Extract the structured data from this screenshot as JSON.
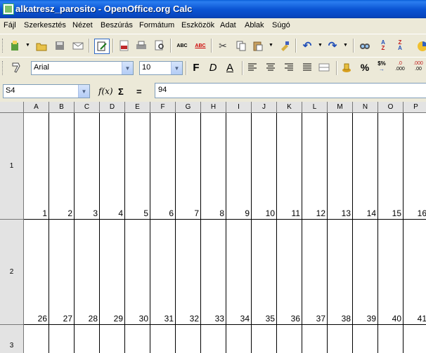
{
  "window": {
    "title": "alkatresz_parosito - OpenOffice.org Calc"
  },
  "menu": [
    "Fájl",
    "Szerkesztés",
    "Nézet",
    "Beszúrás",
    "Formátum",
    "Eszközök",
    "Adat",
    "Ablak",
    "Súgó"
  ],
  "format_toolbar": {
    "font_name": "Arial",
    "font_size": "10"
  },
  "formula_bar": {
    "cell_ref": "S4",
    "formula": "94",
    "function_wizard": "f(x)",
    "sum_symbol": "Σ",
    "equals_symbol": "="
  },
  "columns": [
    "A",
    "B",
    "C",
    "D",
    "E",
    "F",
    "G",
    "H",
    "I",
    "J",
    "K",
    "L",
    "M",
    "N",
    "O",
    "P"
  ],
  "rows": [
    {
      "label": "1",
      "values": [
        "1",
        "2",
        "3",
        "4",
        "5",
        "6",
        "7",
        "8",
        "9",
        "10",
        "11",
        "12",
        "13",
        "14",
        "15",
        "16"
      ]
    },
    {
      "label": "2",
      "values": [
        "26",
        "27",
        "28",
        "29",
        "30",
        "31",
        "32",
        "33",
        "34",
        "35",
        "36",
        "37",
        "38",
        "39",
        "40",
        "41"
      ]
    },
    {
      "label": "3",
      "values": []
    }
  ],
  "toolbar_icons": {
    "standard": [
      "new-document-icon",
      "open-icon",
      "save-icon",
      "email-icon",
      "edit-file-icon",
      "export-pdf-icon",
      "print-icon",
      "page-preview-icon",
      "spellcheck-icon",
      "autospellcheck-icon",
      "cut-icon",
      "copy-icon",
      "paste-icon",
      "format-paintbrush-icon",
      "undo-icon",
      "redo-icon",
      "navigator-icon",
      "sort-ascending-icon",
      "sort-descending-icon",
      "chart-icon"
    ],
    "formatting": [
      "styles-icon",
      "bold-icon",
      "italic-icon",
      "underline-icon",
      "align-left-icon",
      "align-center-icon",
      "align-right-icon",
      "justify-icon",
      "merge-cells-icon",
      "currency-icon",
      "percent-icon",
      "standard-format-icon",
      "add-decimal-icon"
    ]
  }
}
